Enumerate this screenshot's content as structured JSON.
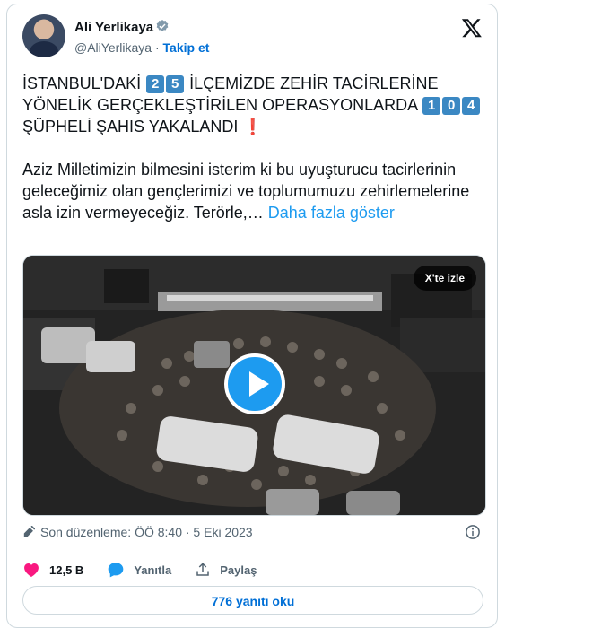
{
  "author": {
    "name": "Ali Yerlikaya",
    "handle": "@AliYerlikaya",
    "separator": " · ",
    "follow_label": "Takip et"
  },
  "tweet": {
    "line1_a": "İSTANBUL'DAKİ ",
    "num_25": [
      "2",
      "5"
    ],
    "line1_b": " İLÇEMİZDE ZEHİR TACİRLERİNE YÖNELİK GERÇEKLEŞTİRİLEN OPERASYONLARDA ",
    "num_104": [
      "1",
      "0",
      "4"
    ],
    "line1_c": " ŞÜPHELİ ŞAHIS YAKALANDI",
    "exclamation": "❗",
    "paragraph2": "Aziz Milletimizin bilmesini isterim ki bu uyuşturucu tacirlerinin geleceğimiz olan gençlerimizi ve toplumumuzu zehirlemelerine asla izin vermeyeceğiz. Terörle,… ",
    "show_more": "Daha fazla göster"
  },
  "media": {
    "watch_label": "X'te izle"
  },
  "meta": {
    "edited_label": "Son düzenleme: ÖÖ 8:40 · 5 Eki 2023"
  },
  "actions": {
    "like_count": "12,5 B",
    "reply_label": "Yanıtla",
    "share_label": "Paylaş"
  },
  "read_replies_label": "776 yanıtı oku",
  "colors": {
    "accent": "#1d9bf0",
    "link": "#006fd6",
    "like": "#f91880",
    "keycap": "#3b88c3"
  }
}
